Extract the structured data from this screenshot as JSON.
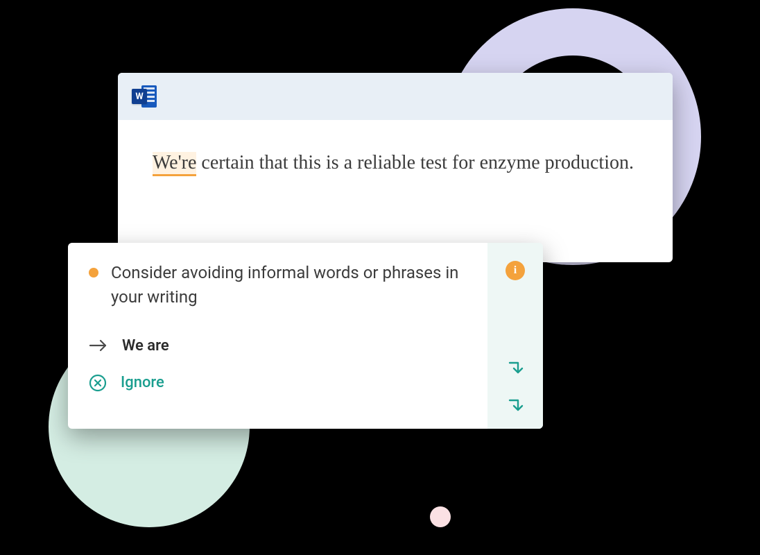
{
  "document": {
    "app_icon_letter": "W",
    "highlighted_word": "We're",
    "rest_text": " certain that this is a reliable test for enzyme production."
  },
  "suggestion": {
    "title": "Consider avoiding informal words or phrases in your writing",
    "replacement": "We are",
    "ignore_label": "Ignore",
    "info_glyph": "i"
  }
}
